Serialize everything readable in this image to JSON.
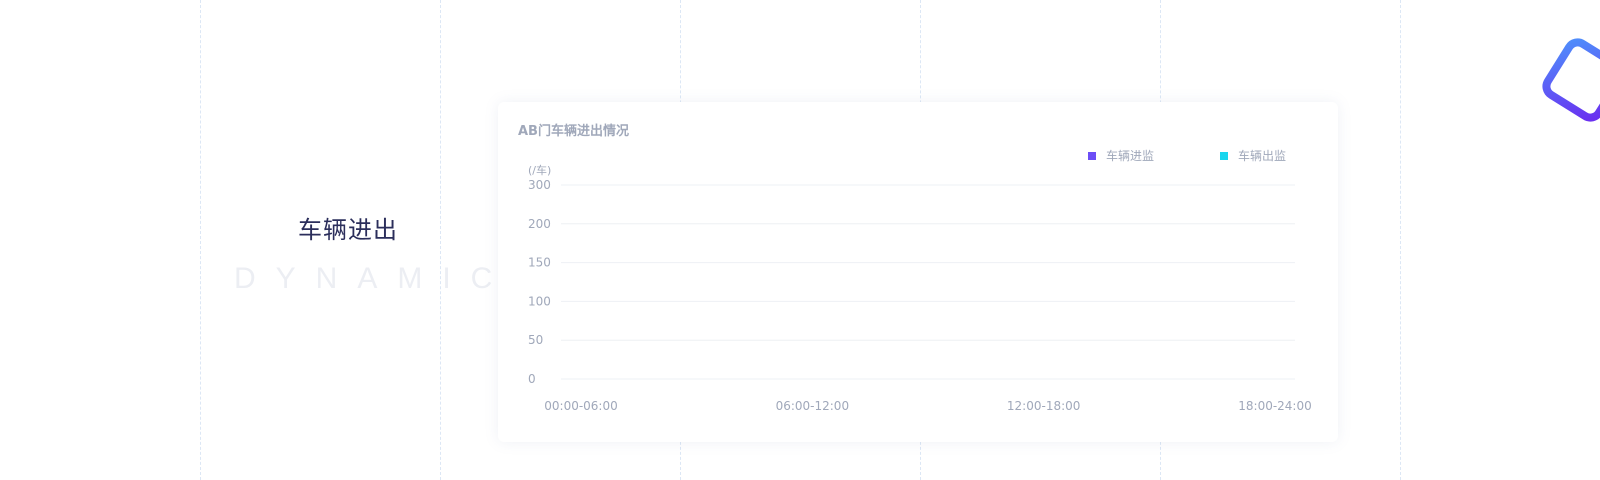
{
  "section": {
    "heading": "车辆进出",
    "subheading": "DYNAMIC"
  },
  "colors": {
    "series_in": "#6c4ef6",
    "series_out": "#19d6ee",
    "grid": "#eef0f4",
    "text": "#a0a8ba",
    "heading": "#2b2e5b",
    "guide": "#dce7f5"
  },
  "chart_data": {
    "type": "bar",
    "title": "AB门车辆进出情况",
    "ylabel": "(/车)",
    "xlabel": "",
    "categories": [
      "00:00-06:00",
      "06:00-12:00",
      "12:00-18:00",
      "18:00-24:00"
    ],
    "y_ticks": [
      "0",
      "50",
      "100",
      "150",
      "200",
      "300"
    ],
    "y_tick_values": [
      0,
      50,
      100,
      150,
      200,
      300
    ],
    "series": [
      {
        "name": "车辆进监",
        "values": [
          0,
          0,
          0,
          0
        ]
      },
      {
        "name": "车辆出监",
        "values": [
          0,
          0,
          0,
          0
        ]
      }
    ],
    "grid": true,
    "legend_position": "top-right"
  }
}
